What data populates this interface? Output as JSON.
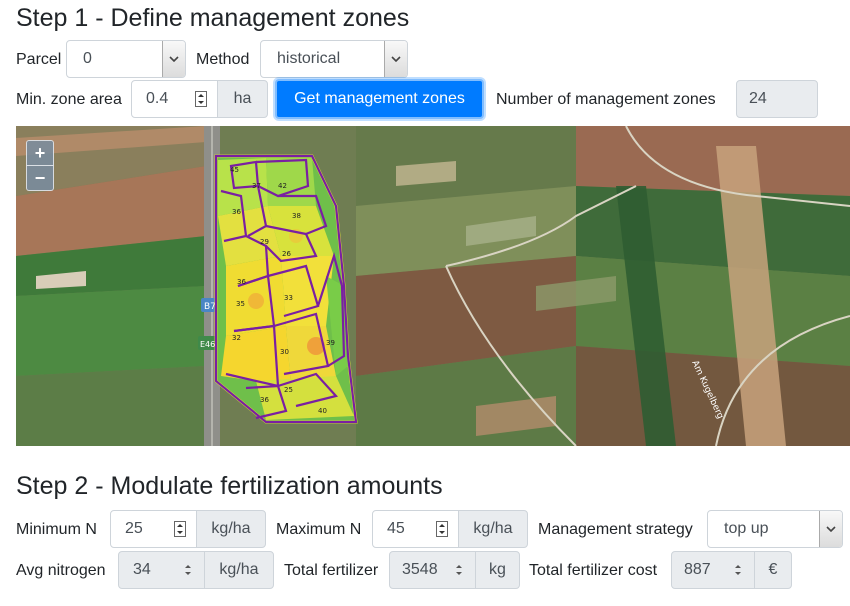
{
  "step1": {
    "title": "Step 1 - Define management zones",
    "parcel_label": "Parcel",
    "parcel_value": "0",
    "method_label": "Method",
    "method_value": "historical",
    "min_zone_label": "Min. zone area",
    "min_zone_value": "0.4",
    "min_zone_unit": "ha",
    "get_zones_button": "Get management zones",
    "num_zones_label": "Number of management zones",
    "num_zones_value": "24"
  },
  "map": {
    "zoom_in": "+",
    "zoom_out": "−",
    "road_labels": [
      "B7",
      "E46"
    ],
    "street_label": "Am Kugelberg",
    "zone_labels": [
      "45",
      "37",
      "42",
      "36",
      "38",
      "29",
      "26",
      "36",
      "35",
      "33",
      "32",
      "30",
      "39",
      "25",
      "36",
      "40"
    ]
  },
  "step2": {
    "title": "Step 2 - Modulate fertilization amounts",
    "min_n_label": "Minimum N",
    "min_n_value": "25",
    "min_n_unit": "kg/ha",
    "max_n_label": "Maximum N",
    "max_n_value": "45",
    "max_n_unit": "kg/ha",
    "strategy_label": "Management strategy",
    "strategy_value": "top up",
    "avg_n_label": "Avg nitrogen",
    "avg_n_value": "34",
    "avg_n_unit": "kg/ha",
    "total_fert_label": "Total fertilizer",
    "total_fert_value": "3548",
    "total_fert_unit": "kg",
    "total_cost_label": "Total fertilizer cost",
    "total_cost_value": "887",
    "total_cost_unit": "€"
  },
  "colors": {
    "accent": "#007bff",
    "zone_border": "#7a1fa2"
  }
}
